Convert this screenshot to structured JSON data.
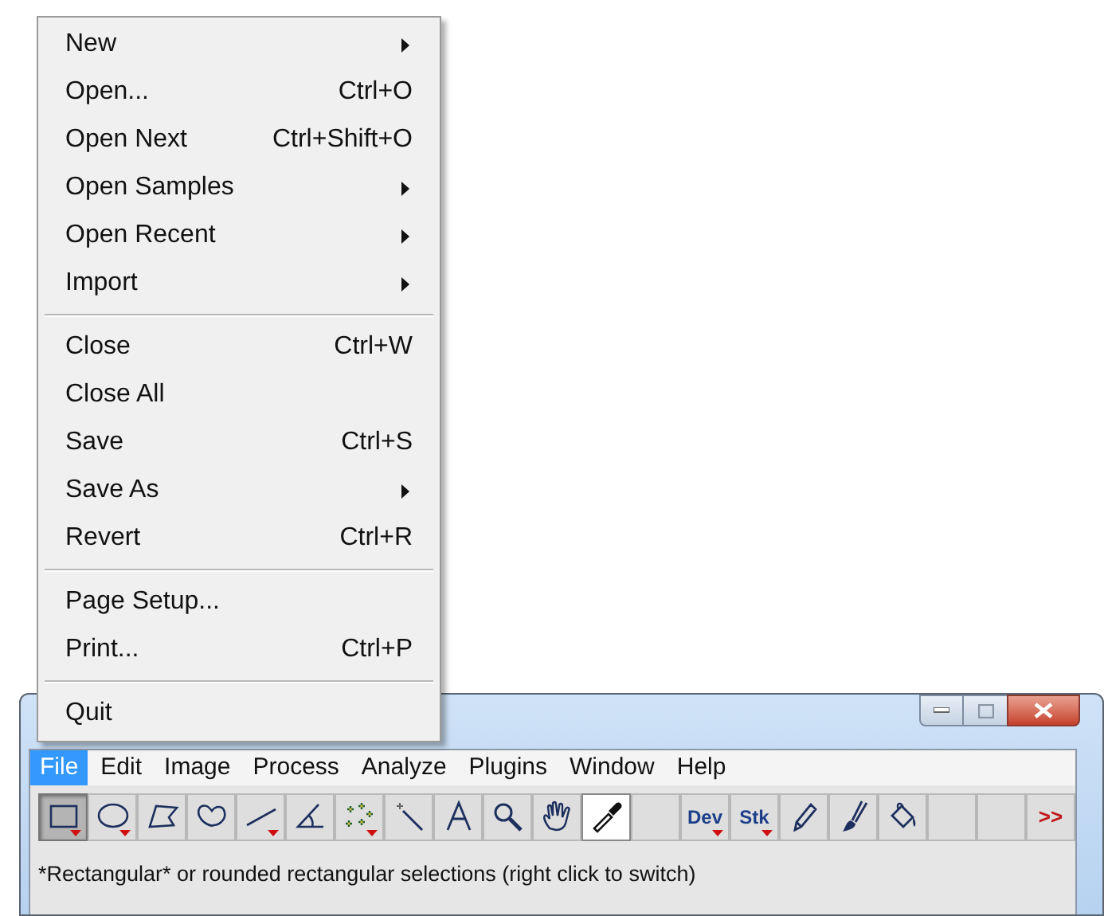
{
  "menu_bar": [
    {
      "label": "File",
      "selected": true
    },
    {
      "label": "Edit",
      "selected": false
    },
    {
      "label": "Image",
      "selected": false
    },
    {
      "label": "Process",
      "selected": false
    },
    {
      "label": "Analyze",
      "selected": false
    },
    {
      "label": "Plugins",
      "selected": false
    },
    {
      "label": "Window",
      "selected": false
    },
    {
      "label": "Help",
      "selected": false
    }
  ],
  "file_menu": [
    {
      "kind": "item",
      "label": "New",
      "submenu": true
    },
    {
      "kind": "item",
      "label": "Open...",
      "shortcut": "Ctrl+O",
      "submenu": false
    },
    {
      "kind": "item",
      "label": "Open Next",
      "shortcut": "Ctrl+Shift+O",
      "submenu": false
    },
    {
      "kind": "item",
      "label": "Open Samples",
      "submenu": true
    },
    {
      "kind": "item",
      "label": "Open Recent",
      "submenu": true
    },
    {
      "kind": "item",
      "label": "Import",
      "submenu": true
    },
    {
      "kind": "separator"
    },
    {
      "kind": "item",
      "label": "Close",
      "shortcut": "Ctrl+W",
      "submenu": false
    },
    {
      "kind": "item",
      "label": "Close All",
      "submenu": false
    },
    {
      "kind": "item",
      "label": "Save",
      "shortcut": "Ctrl+S",
      "submenu": false
    },
    {
      "kind": "item",
      "label": "Save As",
      "submenu": true
    },
    {
      "kind": "item",
      "label": "Revert",
      "shortcut": "Ctrl+R",
      "submenu": false
    },
    {
      "kind": "separator"
    },
    {
      "kind": "item",
      "label": "Page Setup...",
      "submenu": false
    },
    {
      "kind": "item",
      "label": "Print...",
      "shortcut": "Ctrl+P",
      "submenu": false
    },
    {
      "kind": "separator"
    },
    {
      "kind": "item",
      "label": "Quit",
      "submenu": false
    }
  ],
  "toolbar": [
    {
      "kind": "rectangle",
      "selected": true,
      "has_menu": true
    },
    {
      "kind": "oval",
      "selected": false,
      "has_menu": true
    },
    {
      "kind": "polygon",
      "selected": false,
      "has_menu": false
    },
    {
      "kind": "freehand",
      "selected": false,
      "has_menu": false
    },
    {
      "kind": "line",
      "selected": false,
      "has_menu": true
    },
    {
      "kind": "angle",
      "selected": false,
      "has_menu": false
    },
    {
      "kind": "point",
      "selected": false,
      "has_menu": true
    },
    {
      "kind": "wand",
      "selected": false,
      "has_menu": false
    },
    {
      "kind": "text",
      "selected": false,
      "has_menu": false
    },
    {
      "kind": "zoom",
      "selected": false,
      "has_menu": false
    },
    {
      "kind": "hand",
      "selected": false,
      "has_menu": false
    },
    {
      "kind": "dropper",
      "selected": false,
      "has_menu": false
    },
    {
      "kind": "blank",
      "selected": false,
      "has_menu": false
    },
    {
      "kind": "label",
      "label": "Dev",
      "selected": false,
      "has_menu": true
    },
    {
      "kind": "label",
      "label": "Stk",
      "selected": false,
      "has_menu": true
    },
    {
      "kind": "pencil",
      "selected": false,
      "has_menu": false
    },
    {
      "kind": "brush",
      "selected": false,
      "has_menu": false
    },
    {
      "kind": "fill",
      "selected": false,
      "has_menu": false
    },
    {
      "kind": "blank",
      "selected": false,
      "has_menu": false
    },
    {
      "kind": "blank",
      "selected": false,
      "has_menu": false
    },
    {
      "kind": "more",
      "label": ">>",
      "selected": false,
      "has_menu": false
    }
  ],
  "status_bar": "*Rectangular* or rounded rectangular selections (right click to switch)"
}
